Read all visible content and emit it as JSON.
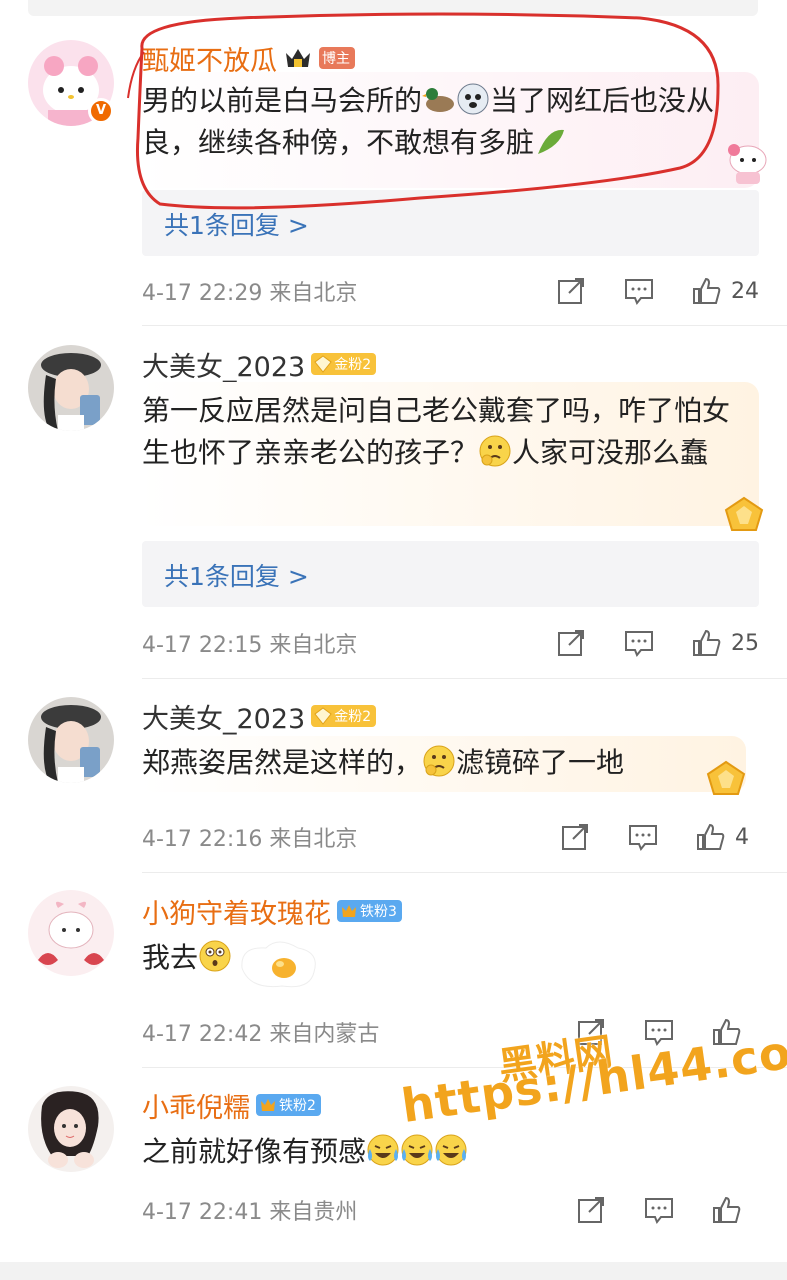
{
  "comments": [
    {
      "username": "甄姬不放瓜",
      "badge": "博主",
      "text": "男的以前是白马会所的",
      "text2": "当了网红后也没从良，继续各种傍，不敢想有多脏",
      "replies": "共1条回复 >",
      "meta": "4-17 22:29 来自北京",
      "likes": "24"
    },
    {
      "username": "大美女_2023",
      "badge": "金粉2",
      "text": "第一反应居然是问自己老公戴套了吗，咋了怕女生也怀了亲亲老公的孩子？",
      "text2": "人家可没那么蠢",
      "replies": "共1条回复 >",
      "meta": "4-17 22:15 来自北京",
      "likes": "25"
    },
    {
      "username": "大美女_2023",
      "badge": "金粉2",
      "text": "郑燕姿居然是这样的，",
      "text2": "滤镜碎了一地",
      "meta": "4-17 22:16 来自北京",
      "likes": "4"
    },
    {
      "username": "小狗守着玫瑰花",
      "badge": "铁粉3",
      "text": "我去",
      "meta": "4-17 22:42 来自内蒙古"
    },
    {
      "username": "小乖倪糯",
      "badge": "铁粉2",
      "text": "之前就好像有预感",
      "meta": "4-17 22:41 来自贵州"
    }
  ],
  "watermark": {
    "title": "黑料网",
    "url": "https://hl44.co"
  },
  "icons": {
    "share": "share-icon",
    "comment": "comment-icon",
    "like": "like-icon"
  },
  "colors": {
    "username_orange": "#e86e13",
    "reply_link": "#3a73b8",
    "annotation_red": "#d9302c"
  }
}
